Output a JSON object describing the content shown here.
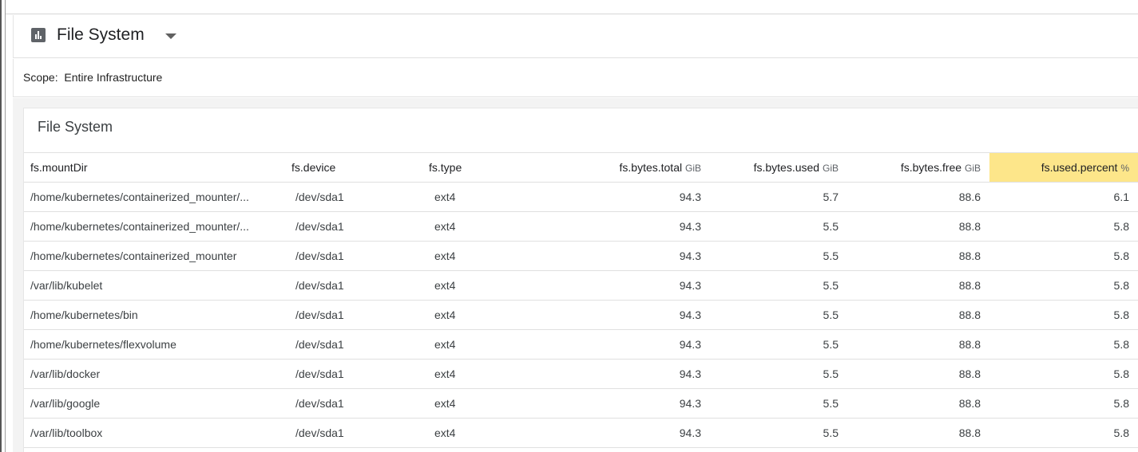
{
  "header": {
    "title": "File System",
    "icon": "bar-chart-icon",
    "dropdown_icon": "caret-down-icon"
  },
  "scope": {
    "label": "Scope:",
    "value": "Entire Infrastructure"
  },
  "panel": {
    "title": "File System"
  },
  "table": {
    "columns": [
      {
        "label": "fs.mountDir",
        "unit": ""
      },
      {
        "label": "fs.device",
        "unit": ""
      },
      {
        "label": "fs.type",
        "unit": ""
      },
      {
        "label": "fs.bytes.total",
        "unit": "GiB"
      },
      {
        "label": "fs.bytes.used",
        "unit": "GiB"
      },
      {
        "label": "fs.bytes.free",
        "unit": "GiB"
      },
      {
        "label": "fs.used.percent",
        "unit": "%"
      }
    ],
    "highlight_color": "#fde68a",
    "rows": [
      [
        "/home/kubernetes/containerized_mounter/...",
        "/dev/sda1",
        "ext4",
        "94.3",
        "5.7",
        "88.6",
        "6.1"
      ],
      [
        "/home/kubernetes/containerized_mounter/...",
        "/dev/sda1",
        "ext4",
        "94.3",
        "5.5",
        "88.8",
        "5.8"
      ],
      [
        "/home/kubernetes/containerized_mounter",
        "/dev/sda1",
        "ext4",
        "94.3",
        "5.5",
        "88.8",
        "5.8"
      ],
      [
        "/var/lib/kubelet",
        "/dev/sda1",
        "ext4",
        "94.3",
        "5.5",
        "88.8",
        "5.8"
      ],
      [
        "/home/kubernetes/bin",
        "/dev/sda1",
        "ext4",
        "94.3",
        "5.5",
        "88.8",
        "5.8"
      ],
      [
        "/home/kubernetes/flexvolume",
        "/dev/sda1",
        "ext4",
        "94.3",
        "5.5",
        "88.8",
        "5.8"
      ],
      [
        "/var/lib/docker",
        "/dev/sda1",
        "ext4",
        "94.3",
        "5.5",
        "88.8",
        "5.8"
      ],
      [
        "/var/lib/google",
        "/dev/sda1",
        "ext4",
        "94.3",
        "5.5",
        "88.8",
        "5.8"
      ],
      [
        "/var/lib/toolbox",
        "/dev/sda1",
        "ext4",
        "94.3",
        "5.5",
        "88.8",
        "5.8"
      ]
    ]
  }
}
